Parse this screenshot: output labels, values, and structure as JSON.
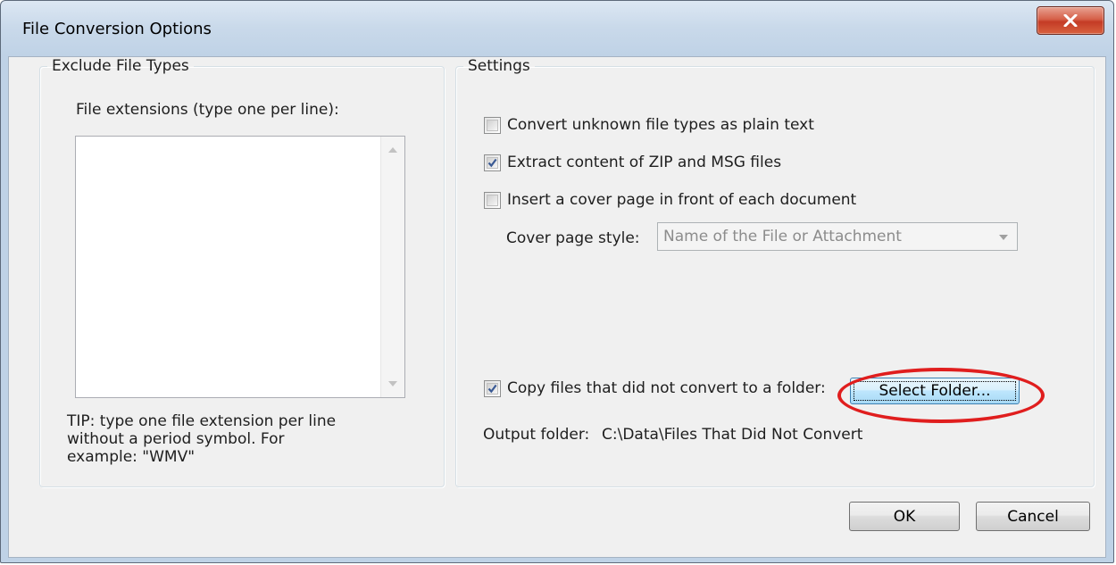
{
  "window": {
    "title": "File Conversion Options"
  },
  "exclude": {
    "legend": "Exclude File Types",
    "extensions_label": "File extensions (type one per line):",
    "extensions_value": "",
    "tip": "TIP: type one file extension per line without a period symbol. For example: \"WMV\""
  },
  "settings": {
    "legend": "Settings",
    "convert_unknown": {
      "label": "Convert unknown file types as plain text",
      "checked": false
    },
    "extract_zip": {
      "label": "Extract content of ZIP and MSG files",
      "checked": true
    },
    "cover_page": {
      "label": "Insert a cover page in front of each document",
      "checked": false
    },
    "cover_style_label": "Cover page style:",
    "cover_style_value": "Name of the File or Attachment",
    "copy_failed": {
      "label": "Copy files that did not convert to a folder:",
      "checked": true
    },
    "select_folder_label": "Select Folder...",
    "output_folder_label": "Output folder:",
    "output_folder_value": "C:\\Data\\Files That Did Not Convert"
  },
  "buttons": {
    "ok": "OK",
    "cancel": "Cancel"
  },
  "colors": {
    "highlight_ellipse": "#e01e1e",
    "close_button": "#c84a32",
    "check_mark": "#3a5a94"
  },
  "icons": {
    "close": "close-icon",
    "check": "check-icon",
    "scroll_up": "scroll-up-arrow-icon",
    "scroll_down": "scroll-down-arrow-icon",
    "dropdown": "chevron-down-icon"
  }
}
